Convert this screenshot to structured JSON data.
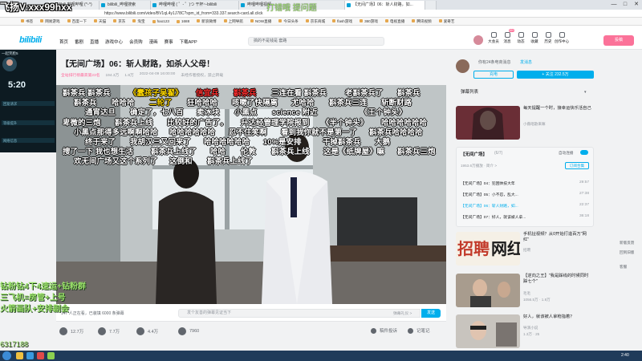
{
  "browser": {
    "tabs": [
      {
        "label": "bilibili 哔哩哔哩 (^-^)",
        "active": false
      },
      {
        "label": "bilibili_哔哩搜索",
        "active": false
      },
      {
        "label": "哔哩哔哩 ( ゜- ゜)つ 干杯~-bilibili",
        "active": false
      },
      {
        "label": "哔哩哔哩视频...",
        "active": false
      },
      {
        "label": "【无间广场】06：斩人财路，如...",
        "active": true
      },
      {
        "label": "",
        "active": false
      }
    ],
    "url": "https://www.bilibili.com/video/BV1qL4y1J78C?spm_id_from=333.337.search-card.all.click",
    "bookmarks": [
      "书签",
      "网易游戏",
      "百度一下",
      "天猫",
      "京东",
      "淘宝",
      "hao123",
      "1688",
      "新浪微博",
      "上网导航",
      "NOW直播",
      "今日头条",
      "京东商城",
      "flash游戏",
      "360游戏",
      "电视直播",
      "腾讯视频",
      "爱奇艺"
    ],
    "window_buttons": [
      "—",
      "□",
      "✕"
    ]
  },
  "header": {
    "logo": "bilibili",
    "nav": [
      "首页",
      "番剧",
      "直播",
      "游戏中心",
      "会员购",
      "漫画",
      "赛事",
      "下载APP"
    ],
    "search_placeholder": "搞的不是钱是 套路",
    "right_nav": [
      "大会员",
      "消息",
      "动态",
      "收藏",
      "历史",
      "创作中心"
    ],
    "message_badge": "99+",
    "upload": "投稿"
  },
  "video": {
    "title": "【无间广场】06：斩人财路，如杀人父母！",
    "badge": "全站排行榜最高第23名",
    "views": "194.3万",
    "danmaku_total": "1.8万",
    "date": "2022-04-09 16:00:00",
    "notice": "未经作者授权，禁止转载",
    "danmaku_count_line": "147 人正在看，已装填 6000 条弹幕",
    "danmaku_placeholder": "发个友善的弹幕见证当下",
    "danmaku_etiquette": "弹幕礼仪 >",
    "send": "发送",
    "actions": {
      "like": "12.7万",
      "coin": "7.7万",
      "fav": "4.4万",
      "share": "7960",
      "report": "稿件投诉",
      "note": "记笔记"
    }
  },
  "danmaku": [
    "斟茶兵 斟茶兵",
    "《蠢孩子吴翟》",
    "信宜兵",
    "斟茶兵",
    "三连在看 斟茶兵",
    "老斟茶兵了",
    "斟茶兵",
    "斟茶兵",
    "哈哈哈",
    "二轮了",
    "狂哈哈哈",
    "咳嗽了快隔离",
    "尤哈哈",
    "斟茶兵三连",
    "斩断财路",
    "通宵达旦",
    "确定了，七八百",
    "卖冰块",
    "小黑点",
    "science 附近",
    "《王个钟头》",
    "卑微的三炮",
    "斟茶兵上线",
    "比较好的广告了。",
    "升达经管理学院报到",
    "《半个钟头》",
    "哈哈哈哈哈哈",
    "小黑点那得多远啊啊哈哈",
    "哈哈哈哈哈哈",
    "忍不住笑啊",
    "看到我你就不是第一了",
    "斟茶兵哈哈哈哈",
    "终于来了",
    "我胡汉三又回来了",
    "哈哈哈哈哈哈",
    "10%是安排",
    "干掉斟茶兵",
    "大鹅",
    "搜了一下 我也想生活",
    "斟茶兵上线了",
    "哈哈",
    "伦敦",
    "斟茶兵上线",
    "这是《纸牌屋》嘛",
    "斟茶兵三炮",
    "欢无间广场又这个系列了",
    "这倒和",
    "斟茶兵上线了"
  ],
  "sidebar": {
    "up_name": "你有24条电商消息",
    "up_send": "发消息",
    "charge": "充电",
    "follow": "+ 关注 232.5万",
    "dm_list": "弹幕列表",
    "rec1": {
      "title": "每天提醒一个时，接幸运快乐活自己",
      "author": "小薇唱歌来嘛",
      "duration": ""
    },
    "collection": {
      "title": "【无间广场】",
      "count": "(6/7)",
      "autoplay": "自动连播",
      "views": "1953.6万播放 · 简介 >",
      "subscribe": "订阅合集"
    },
    "episodes": [
      {
        "title": "【无间广场】04：犯困休技大年",
        "dur": "29:57"
      },
      {
        "title": "【无间广场】05：小不忍，乱大...",
        "dur": "27:38"
      },
      {
        "title": "【无间广场】06：斩人财路，如...",
        "dur": "22:37",
        "current": true
      },
      {
        "title": "【无间广场】07：好人，就该被人拿...",
        "dur": "36:18"
      }
    ],
    "rec2": {
      "title": "手机扯视频？从0开始打造百万\"网红\"",
      "author": "招聘",
      "views": "",
      "duration": ""
    },
    "rec3": {
      "title": "【逆向之王】\"我是踩线的时候同时踩七个\"",
      "author": "毛毛",
      "views": "1056.5万",
      "dm": "1.8万"
    },
    "rec4": {
      "title": "好人，就该被人拿枪指着？",
      "author": "导演小说",
      "views": "1.3万",
      "dm": "25"
    },
    "float": [
      "新版反馈",
      "回到旧版",
      "客服"
    ]
  },
  "overlay": {
    "watermark": "飞扬V:xxx99hxx",
    "top_green": "打错哦 提问题",
    "left_panel_title": "一起笑脸5",
    "timer": "5:20",
    "left_rows": [
      "回复请求",
      "等级提升",
      "网络信息"
    ],
    "left_green": [
      "钻粉钻4下4速运+钻粉群",
      "三飞机=房管+上号",
      "火箭画队+安排剧会"
    ],
    "id": "6317188"
  },
  "taskbar": {
    "clock": "2:40"
  }
}
